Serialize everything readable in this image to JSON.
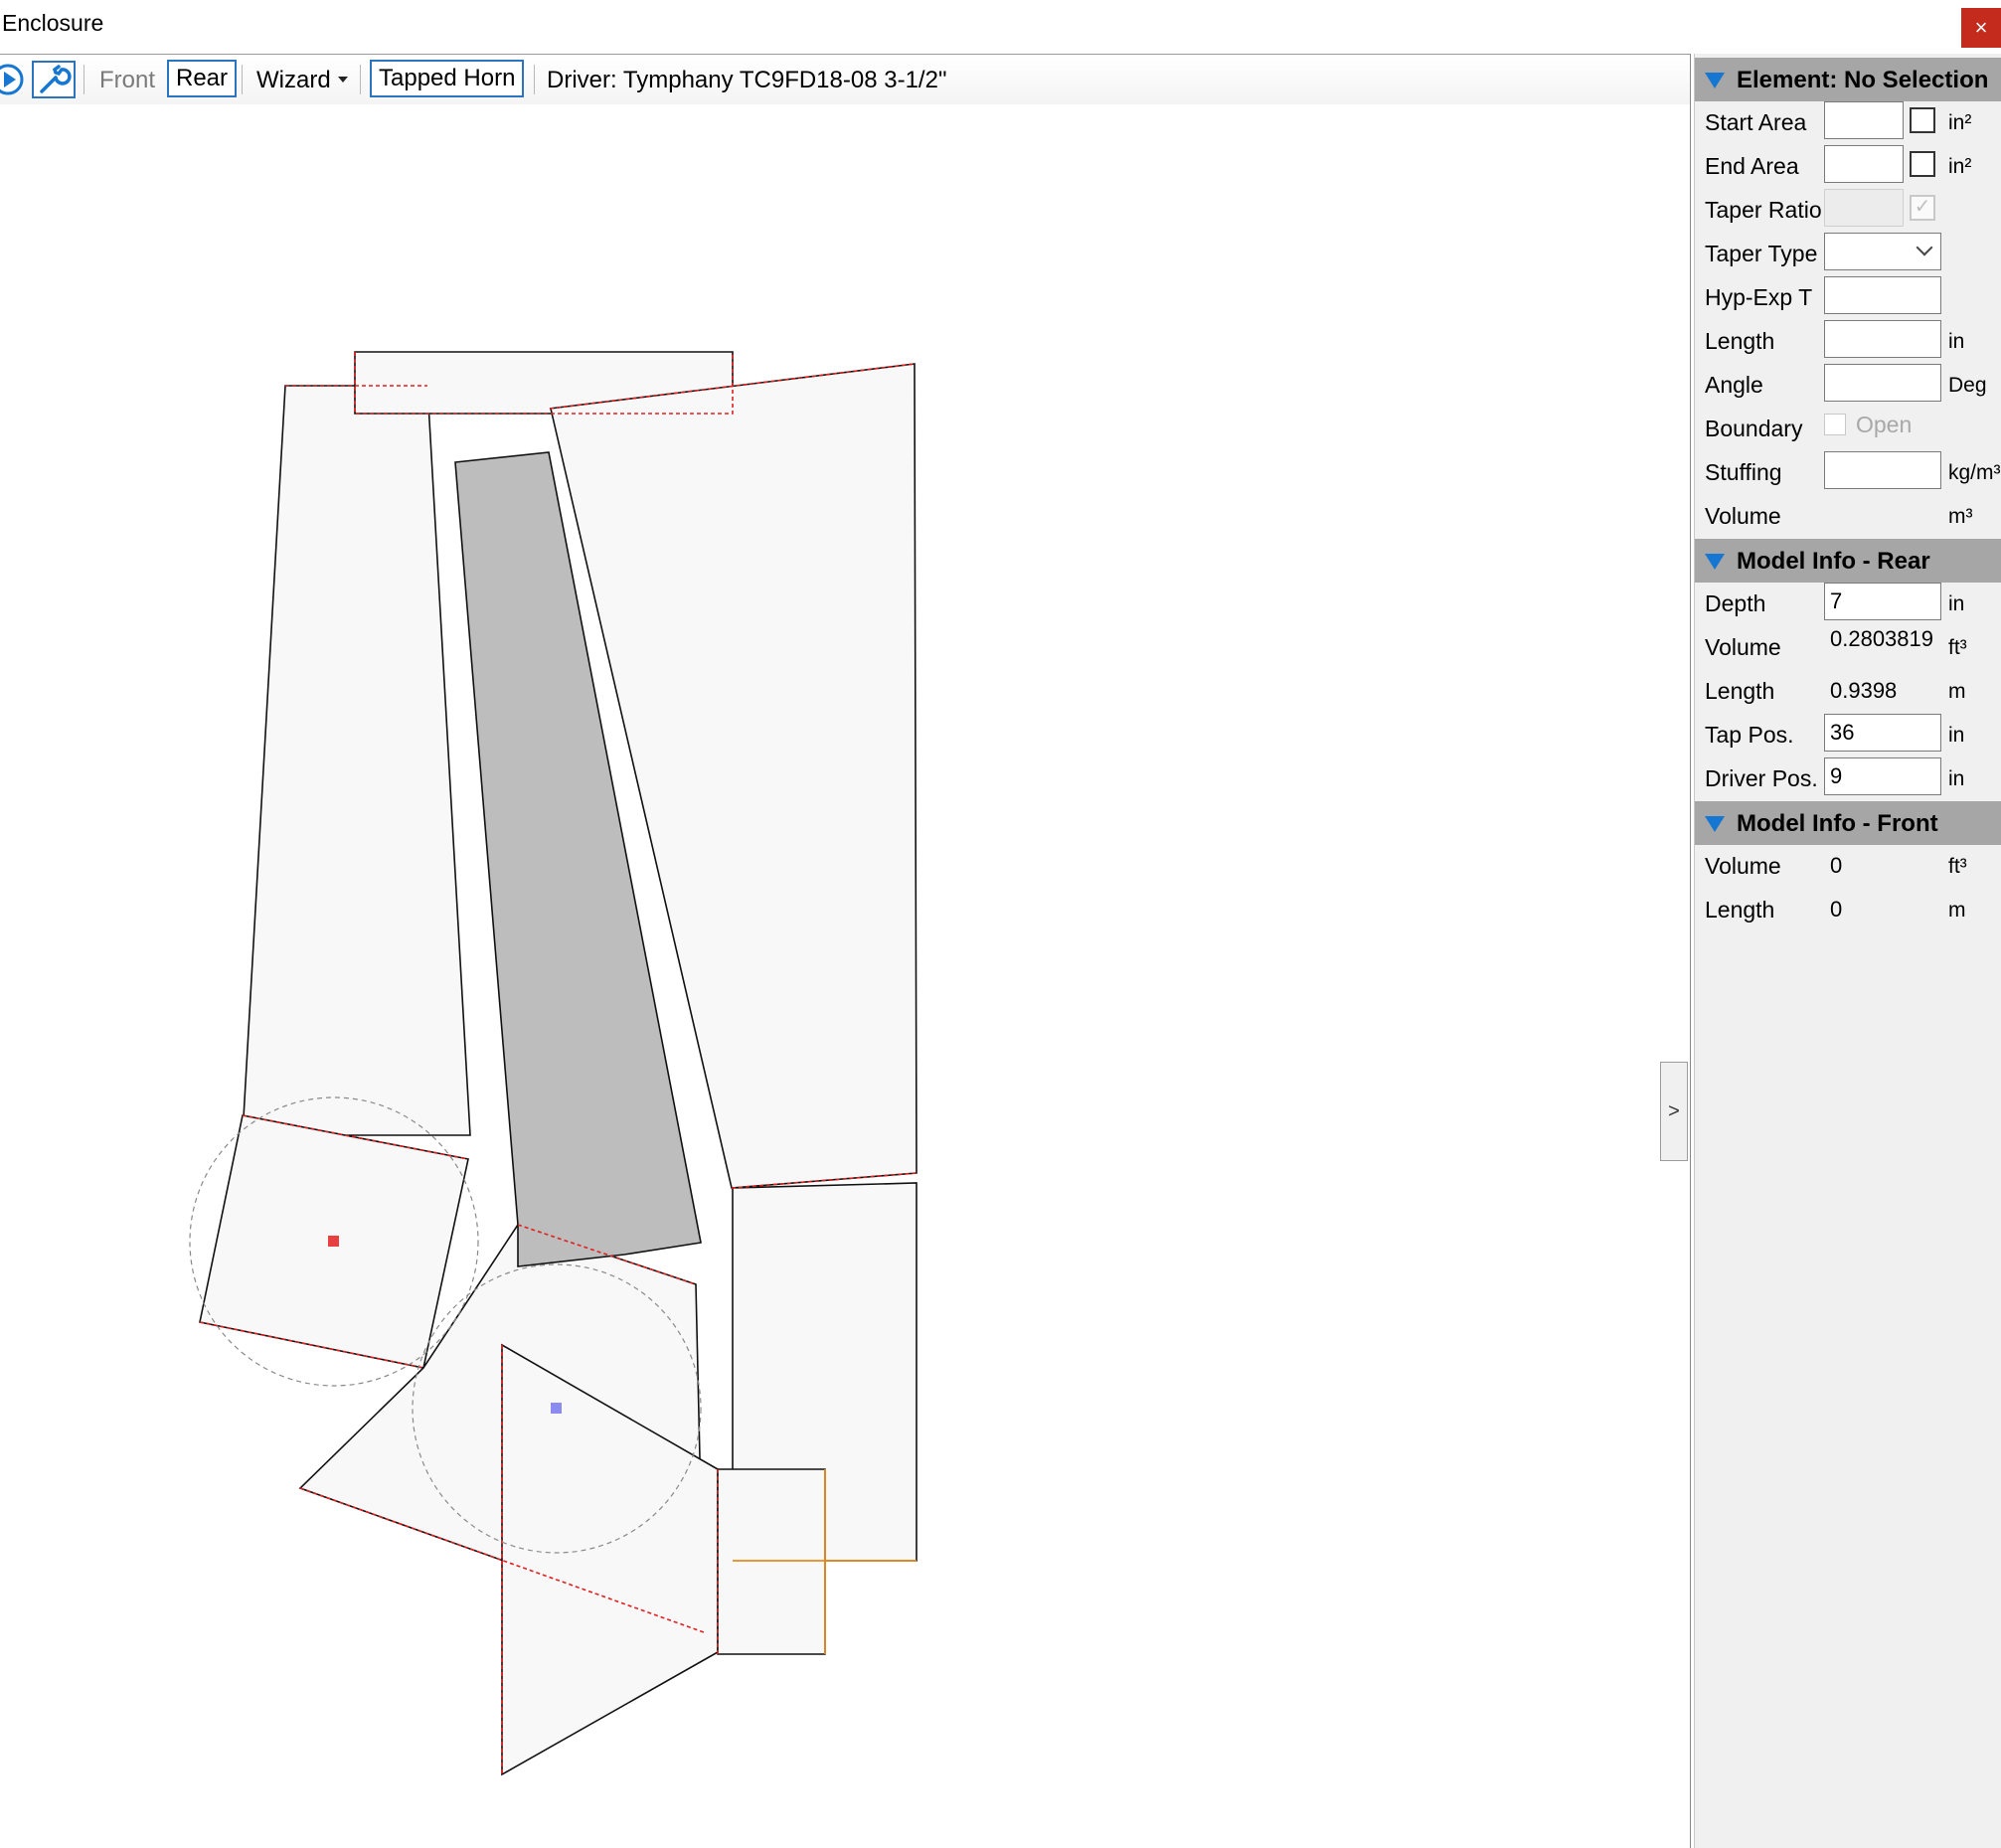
{
  "window": {
    "title": "Enclosure",
    "close_glyph": "×"
  },
  "toolbar": {
    "front_label": "Front",
    "rear_label": "Rear",
    "wizard_label": "Wizard",
    "tapped_horn_label": "Tapped Horn",
    "driver_text": "Driver: Tymphany TC9FD18-08 3-1/2\"",
    "icons": [
      "play-icon",
      "wrench-icon",
      "dropdown-arrow-icon"
    ]
  },
  "collapse_tab": {
    "glyph": ">"
  },
  "panel": {
    "element": {
      "header": "Element: No Selection",
      "start_area": {
        "label": "Start Area",
        "value": "",
        "unit": "in²"
      },
      "end_area": {
        "label": "End Area",
        "value": "",
        "unit": "in²"
      },
      "taper_ratio": {
        "label": "Taper Ratio",
        "value": ""
      },
      "taper_type": {
        "label": "Taper Type",
        "value": ""
      },
      "hyp_exp": {
        "label": "Hyp-Exp T",
        "value": ""
      },
      "length": {
        "label": "Length",
        "value": "",
        "unit": "in"
      },
      "angle": {
        "label": "Angle",
        "value": "",
        "unit": "Deg"
      },
      "boundary": {
        "label": "Boundary",
        "option": "Open"
      },
      "stuffing": {
        "label": "Stuffing",
        "value": "",
        "unit": "kg/m³"
      },
      "volume": {
        "label": "Volume",
        "unit": "m³"
      }
    },
    "rear": {
      "header": "Model Info - Rear",
      "depth": {
        "label": "Depth",
        "value": "7",
        "unit": "in"
      },
      "volume": {
        "label": "Volume",
        "value": "0.2803819",
        "unit": "ft³"
      },
      "length": {
        "label": "Length",
        "value": "0.9398",
        "unit": "m"
      },
      "tap_pos": {
        "label": "Tap Pos.",
        "value": "36",
        "unit": "in"
      },
      "driver_pos": {
        "label": "Driver Pos.",
        "value": "9",
        "unit": "in"
      }
    },
    "front": {
      "header": "Model Info - Front",
      "volume": {
        "label": "Volume",
        "value": "0",
        "unit": "ft³"
      },
      "length": {
        "label": "Length",
        "value": "0",
        "unit": "m"
      }
    }
  },
  "colors": {
    "close_button": "#c42b1c",
    "accent_blue": "#1677d2",
    "section_header": "#a6a6a6",
    "boundary_red": "#e02020",
    "tap_orange": "#e88a1a",
    "driver_marker": "#8c8cf0",
    "mouth_marker": "#e84040"
  }
}
